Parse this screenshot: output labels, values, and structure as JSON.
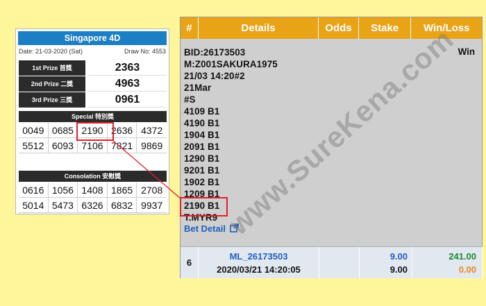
{
  "results_card": {
    "title": "Singapore 4D",
    "date": "Date: 21-03-2020 (Sat)",
    "draw_no": "Draw No: 4553",
    "prizes": [
      {
        "label": "1st Prize 首獎",
        "number": "2363"
      },
      {
        "label": "2nd Prize 二獎",
        "number": "4963"
      },
      {
        "label": "3rd Prize 三獎",
        "number": "0961"
      }
    ],
    "special_label": "Special 特別獎",
    "special_numbers": [
      "0049",
      "0685",
      "2190",
      "2636",
      "4372",
      "5512",
      "6093",
      "7106",
      "7821",
      "9869"
    ],
    "consolation_label": "Consolation 安慰獎",
    "consolation_numbers": [
      "0616",
      "1056",
      "1408",
      "1865",
      "2708",
      "5014",
      "5473",
      "6326",
      "6832",
      "9937"
    ]
  },
  "bet_table": {
    "headers": [
      "#",
      "Details",
      "Odds",
      "Stake",
      "Win/Loss"
    ],
    "detail_lines": [
      "BID:26173503",
      "M:Z001SAKURA1975",
      "21/03 14:20#2",
      "21Mar",
      "#S",
      "4109 B1",
      "4190 B1",
      "1904 B1",
      "2091 B1",
      "1290 B1",
      "9201 B1",
      "1902 B1",
      "1209 B1",
      "2190 B1",
      "T.MYR9"
    ],
    "status": "Win",
    "bet_detail_link": "Bet Detail",
    "row": {
      "index": "6",
      "id": "ML_26173503",
      "timestamp": "2020/03/21 14:20:05",
      "stake": "9.00",
      "stake_total": "9.00",
      "win_amount": "241.00",
      "loss_amount": "0.00"
    }
  },
  "watermark": "www.SureKena.com",
  "colors": {
    "background": "#fff69b",
    "header": "#e8a317",
    "title_bar": "#1c7ec3",
    "highlight": "#e0202a"
  }
}
